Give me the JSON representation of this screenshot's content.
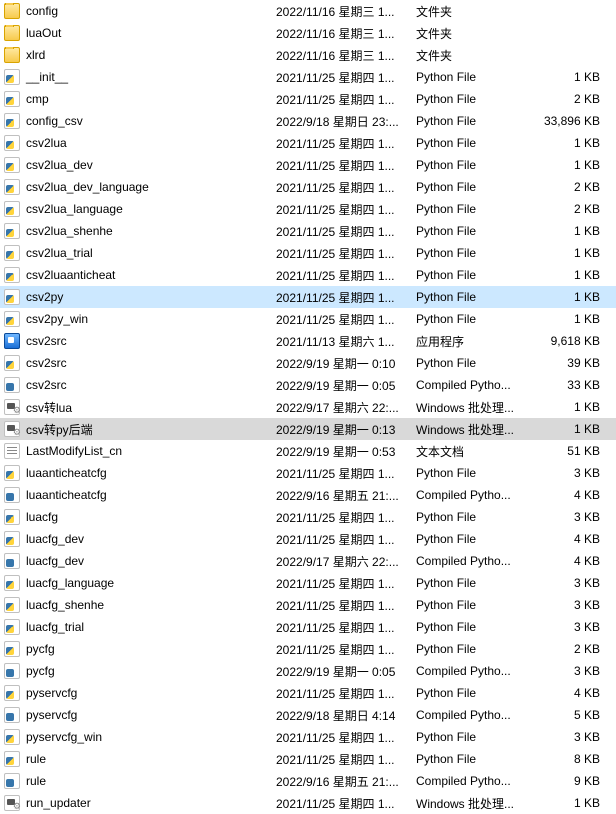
{
  "files": [
    {
      "name": "config",
      "date": "2022/11/16 星期三 1...",
      "type": "文件夹",
      "size": "",
      "icon": "folder"
    },
    {
      "name": "luaOut",
      "date": "2022/11/16 星期三 1...",
      "type": "文件夹",
      "size": "",
      "icon": "folder"
    },
    {
      "name": "xlrd",
      "date": "2022/11/16 星期三 1...",
      "type": "文件夹",
      "size": "",
      "icon": "folder"
    },
    {
      "name": "__init__",
      "date": "2021/11/25 星期四 1...",
      "type": "Python File",
      "size": "1 KB",
      "icon": "py"
    },
    {
      "name": "cmp",
      "date": "2021/11/25 星期四 1...",
      "type": "Python File",
      "size": "2 KB",
      "icon": "py"
    },
    {
      "name": "config_csv",
      "date": "2022/9/18 星期日 23:...",
      "type": "Python File",
      "size": "33,896 KB",
      "icon": "py"
    },
    {
      "name": "csv2lua",
      "date": "2021/11/25 星期四 1...",
      "type": "Python File",
      "size": "1 KB",
      "icon": "py"
    },
    {
      "name": "csv2lua_dev",
      "date": "2021/11/25 星期四 1...",
      "type": "Python File",
      "size": "1 KB",
      "icon": "py"
    },
    {
      "name": "csv2lua_dev_language",
      "date": "2021/11/25 星期四 1...",
      "type": "Python File",
      "size": "2 KB",
      "icon": "py"
    },
    {
      "name": "csv2lua_language",
      "date": "2021/11/25 星期四 1...",
      "type": "Python File",
      "size": "2 KB",
      "icon": "py"
    },
    {
      "name": "csv2lua_shenhe",
      "date": "2021/11/25 星期四 1...",
      "type": "Python File",
      "size": "1 KB",
      "icon": "py"
    },
    {
      "name": "csv2lua_trial",
      "date": "2021/11/25 星期四 1...",
      "type": "Python File",
      "size": "1 KB",
      "icon": "py"
    },
    {
      "name": "csv2luaanticheat",
      "date": "2021/11/25 星期四 1...",
      "type": "Python File",
      "size": "1 KB",
      "icon": "py"
    },
    {
      "name": "csv2py",
      "date": "2021/11/25 星期四 1...",
      "type": "Python File",
      "size": "1 KB",
      "icon": "py",
      "state": "selected"
    },
    {
      "name": "csv2py_win",
      "date": "2021/11/25 星期四 1...",
      "type": "Python File",
      "size": "1 KB",
      "icon": "py"
    },
    {
      "name": "csv2src",
      "date": "2021/11/13 星期六 1...",
      "type": "应用程序",
      "size": "9,618 KB",
      "icon": "exe"
    },
    {
      "name": "csv2src",
      "date": "2022/9/19 星期一 0:10",
      "type": "Python File",
      "size": "39 KB",
      "icon": "py"
    },
    {
      "name": "csv2src",
      "date": "2022/9/19 星期一 0:05",
      "type": "Compiled Pytho...",
      "size": "33 KB",
      "icon": "pyc"
    },
    {
      "name": "csv转lua",
      "date": "2022/9/17 星期六 22:...",
      "type": "Windows 批处理...",
      "size": "1 KB",
      "icon": "bat"
    },
    {
      "name": "csv转py后端",
      "date": "2022/9/19 星期一 0:13",
      "type": "Windows 批处理...",
      "size": "1 KB",
      "icon": "bat",
      "state": "highlighted"
    },
    {
      "name": "LastModifyList_cn",
      "date": "2022/9/19 星期一 0:53",
      "type": "文本文档",
      "size": "51 KB",
      "icon": "txt"
    },
    {
      "name": "luaanticheatcfg",
      "date": "2021/11/25 星期四 1...",
      "type": "Python File",
      "size": "3 KB",
      "icon": "py"
    },
    {
      "name": "luaanticheatcfg",
      "date": "2022/9/16 星期五 21:...",
      "type": "Compiled Pytho...",
      "size": "4 KB",
      "icon": "pyc"
    },
    {
      "name": "luacfg",
      "date": "2021/11/25 星期四 1...",
      "type": "Python File",
      "size": "3 KB",
      "icon": "py"
    },
    {
      "name": "luacfg_dev",
      "date": "2021/11/25 星期四 1...",
      "type": "Python File",
      "size": "4 KB",
      "icon": "py"
    },
    {
      "name": "luacfg_dev",
      "date": "2022/9/17 星期六 22:...",
      "type": "Compiled Pytho...",
      "size": "4 KB",
      "icon": "pyc"
    },
    {
      "name": "luacfg_language",
      "date": "2021/11/25 星期四 1...",
      "type": "Python File",
      "size": "3 KB",
      "icon": "py"
    },
    {
      "name": "luacfg_shenhe",
      "date": "2021/11/25 星期四 1...",
      "type": "Python File",
      "size": "3 KB",
      "icon": "py"
    },
    {
      "name": "luacfg_trial",
      "date": "2021/11/25 星期四 1...",
      "type": "Python File",
      "size": "3 KB",
      "icon": "py"
    },
    {
      "name": "pycfg",
      "date": "2021/11/25 星期四 1...",
      "type": "Python File",
      "size": "2 KB",
      "icon": "py"
    },
    {
      "name": "pycfg",
      "date": "2022/9/19 星期一 0:05",
      "type": "Compiled Pytho...",
      "size": "3 KB",
      "icon": "pyc"
    },
    {
      "name": "pyservcfg",
      "date": "2021/11/25 星期四 1...",
      "type": "Python File",
      "size": "4 KB",
      "icon": "py"
    },
    {
      "name": "pyservcfg",
      "date": "2022/9/18 星期日 4:14",
      "type": "Compiled Pytho...",
      "size": "5 KB",
      "icon": "pyc"
    },
    {
      "name": "pyservcfg_win",
      "date": "2021/11/25 星期四 1...",
      "type": "Python File",
      "size": "3 KB",
      "icon": "py"
    },
    {
      "name": "rule",
      "date": "2021/11/25 星期四 1...",
      "type": "Python File",
      "size": "8 KB",
      "icon": "py"
    },
    {
      "name": "rule",
      "date": "2022/9/16 星期五 21:...",
      "type": "Compiled Pytho...",
      "size": "9 KB",
      "icon": "pyc"
    },
    {
      "name": "run_updater",
      "date": "2021/11/25 星期四 1...",
      "type": "Windows 批处理...",
      "size": "1 KB",
      "icon": "bat"
    }
  ]
}
